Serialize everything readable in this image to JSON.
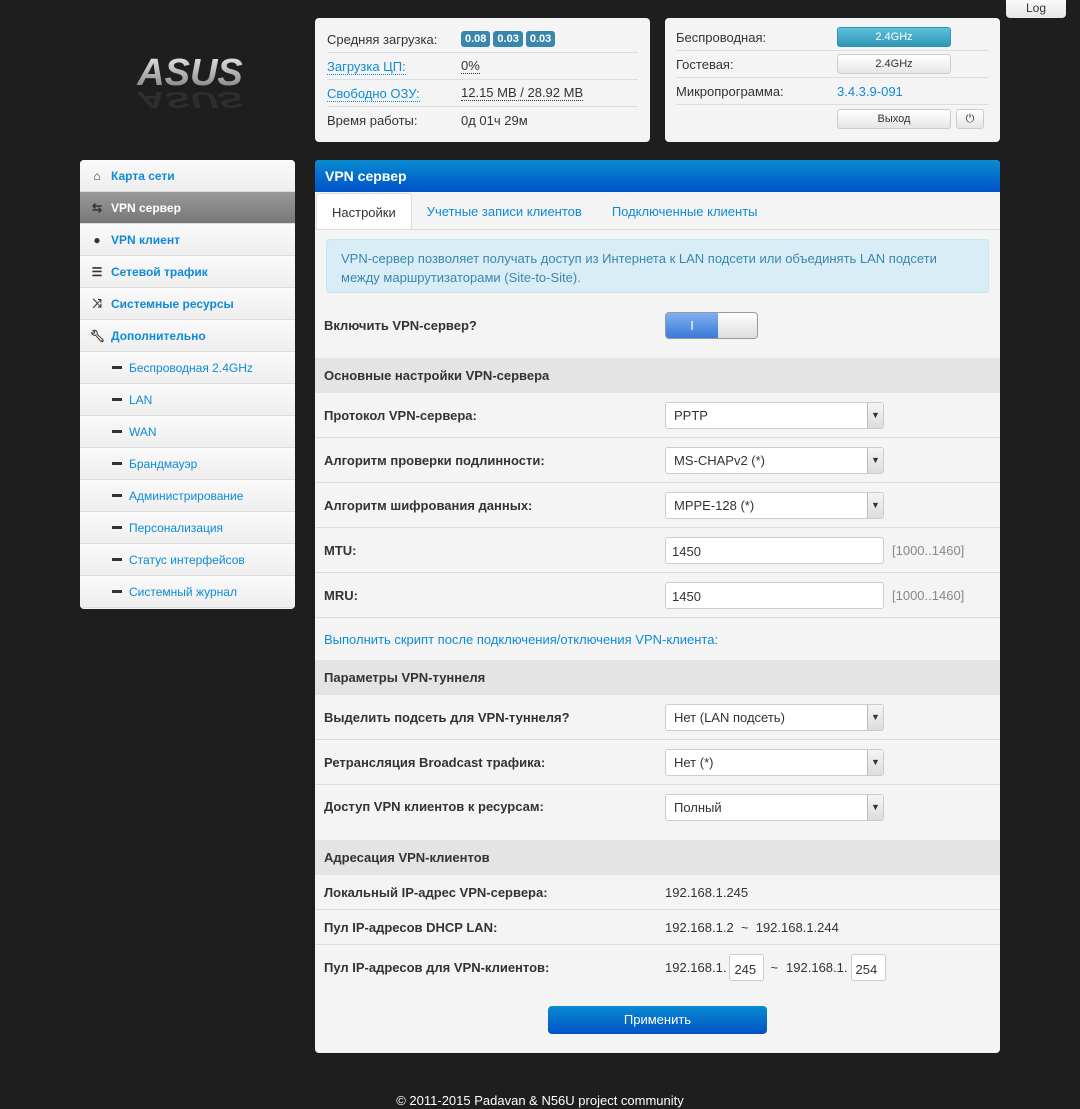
{
  "logo": "ASUS",
  "log_button": "Log",
  "status": {
    "load_label": "Средняя загрузка:",
    "load": [
      "0.08",
      "0.03",
      "0.03"
    ],
    "cpu_label": "Загрузка ЦП:",
    "cpu": "0%",
    "ram_label": "Свободно ОЗУ:",
    "ram": "12.15 MB / 28.92 MB",
    "uptime_label": "Время работы:",
    "uptime": "0д 01ч 29м"
  },
  "wireless": {
    "wifi_label": "Беспроводная:",
    "wifi_btn": "2.4GHz",
    "guest_label": "Гостевая:",
    "guest_btn": "2.4GHz",
    "fw_label": "Микропрограмма:",
    "fw": "3.4.3.9-091",
    "logout": "Выход"
  },
  "sidebar": {
    "items": [
      {
        "label": "Карта сети"
      },
      {
        "label": "VPN сервер"
      },
      {
        "label": "VPN клиент"
      },
      {
        "label": "Сетевой трафик"
      },
      {
        "label": "Системные ресурсы"
      },
      {
        "label": "Дополнительно"
      },
      {
        "label": "Беспроводная 2.4GHz"
      },
      {
        "label": "LAN"
      },
      {
        "label": "WAN"
      },
      {
        "label": "Брандмауэр"
      },
      {
        "label": "Администрирование"
      },
      {
        "label": "Персонализация"
      },
      {
        "label": "Статус интерфейсов"
      },
      {
        "label": "Системный журнал"
      }
    ]
  },
  "main": {
    "title": "VPN сервер",
    "tabs": [
      "Настройки",
      "Учетные записи клиентов",
      "Подключенные клиенты"
    ],
    "alert": "VPN-сервер позволяет получать доступ из Интернета к LAN подсети или объединять LAN подсети между маршрутизаторами (Site-to-Site).",
    "enable_label": "Включить VPN-сервер?",
    "enable_on": "I",
    "sec1": "Основные настройки VPN-сервера",
    "protocol_label": "Протокол VPN-сервера:",
    "protocol": "PPTP",
    "auth_label": "Алгоритм проверки подлинности:",
    "auth": "MS-CHAPv2 (*)",
    "enc_label": "Алгоритм шифрования данных:",
    "enc": "MPPE-128 (*)",
    "mtu_label": "MTU:",
    "mtu": "1450",
    "mtu_hint": "[1000..1460]",
    "mru_label": "MRU:",
    "mru": "1450",
    "mru_hint": "[1000..1460]",
    "script_link": "Выполнить скрипт после подключения/отключения VPN-клиента:",
    "sec2": "Параметры VPN-туннеля",
    "subnet_label": "Выделить подсеть для VPN-туннеля?",
    "subnet": "Нет (LAN подсеть)",
    "bcast_label": "Ретрансляция Broadcast трафика:",
    "bcast": "Нет (*)",
    "access_label": "Доступ VPN клиентов к ресурсам:",
    "access": "Полный",
    "sec3": "Адресация VPN-клиентов",
    "localip_label": "Локальный IP-адрес VPN-сервера:",
    "localip": "192.168.1.245",
    "dhcp_label": "Пул IP-адресов DHCP LAN:",
    "dhcp": "192.168.1.2  ~  192.168.1.244",
    "pool_label": "Пул IP-адресов для VPN-клиентов:",
    "pool_prefix1": "192.168.1.",
    "pool_start": "245",
    "pool_sep": "~",
    "pool_prefix2": "192.168.1.",
    "pool_end": "254",
    "apply": "Применить"
  },
  "footer": "© 2011-2015 Padavan & N56U project community"
}
